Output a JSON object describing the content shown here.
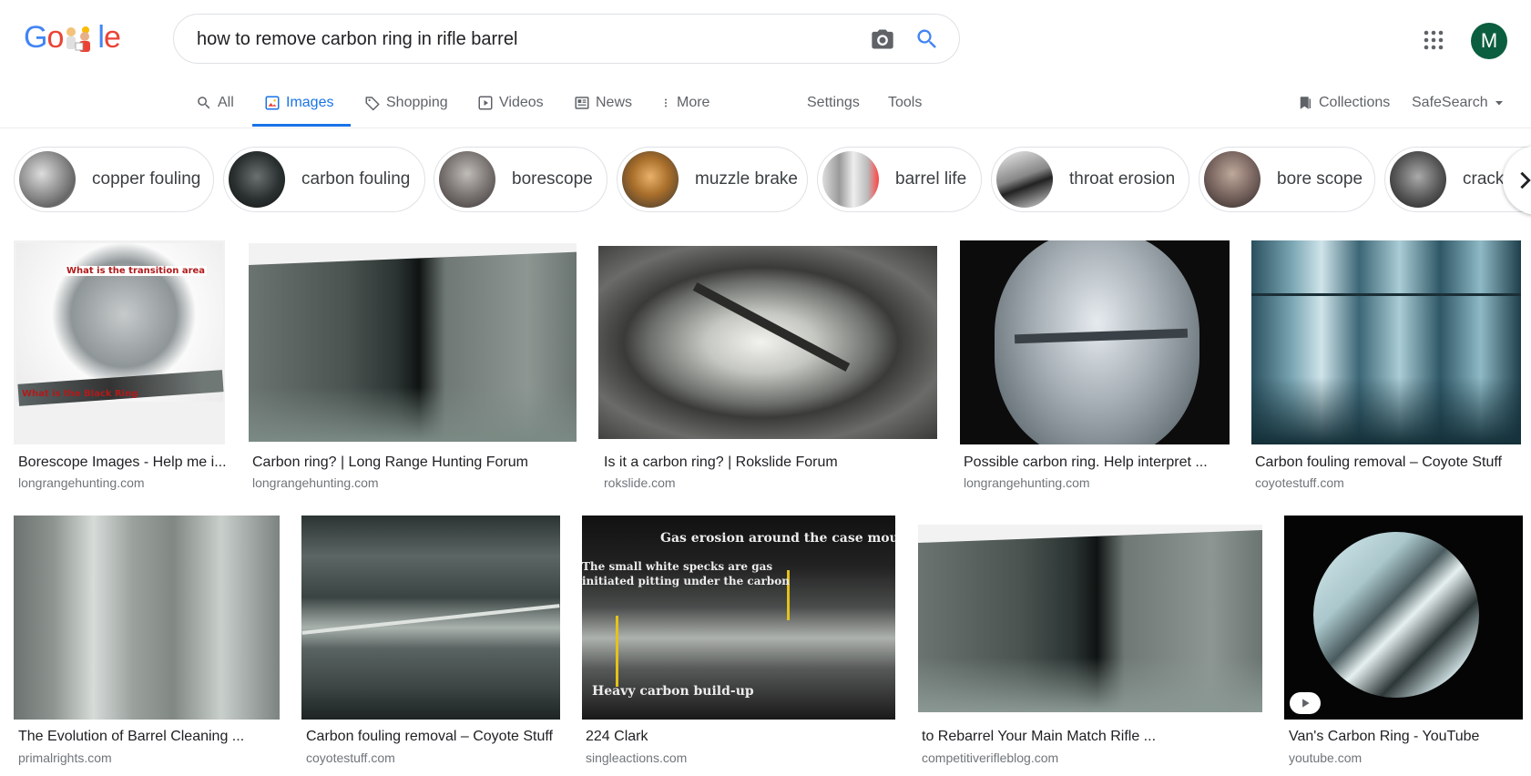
{
  "header": {
    "logo_text": "Google",
    "search_query": "how to remove carbon ring in rifle barrel",
    "avatar_letter": "M"
  },
  "tabs": [
    {
      "label": "All",
      "icon": "search-icon"
    },
    {
      "label": "Images",
      "icon": "image-icon",
      "active": true
    },
    {
      "label": "Shopping",
      "icon": "tag-icon"
    },
    {
      "label": "Videos",
      "icon": "video-icon"
    },
    {
      "label": "News",
      "icon": "news-icon"
    },
    {
      "label": "More",
      "icon": "more-vert-icon"
    }
  ],
  "tools": {
    "settings": "Settings",
    "tools": "Tools",
    "collections": "Collections",
    "safesearch": "SafeSearch"
  },
  "chips": [
    {
      "label": "copper fouling"
    },
    {
      "label": "carbon fouling"
    },
    {
      "label": "borescope"
    },
    {
      "label": "muzzle brake"
    },
    {
      "label": "barrel life"
    },
    {
      "label": "throat erosion"
    },
    {
      "label": "bore scope"
    },
    {
      "label": "cracking"
    }
  ],
  "results": [
    {
      "title": "Borescope Images - Help me i...",
      "site": "longrangehunting.com",
      "overlay": [
        "What is the transition area",
        "What is the Black Ring"
      ]
    },
    {
      "title": "Carbon ring? | Long Range Hunting Forum",
      "site": "longrangehunting.com"
    },
    {
      "title": "Is it a carbon ring? | Rokslide Forum",
      "site": "rokslide.com"
    },
    {
      "title": "Possible carbon ring. Help interpret ...",
      "site": "longrangehunting.com"
    },
    {
      "title": "Carbon fouling removal – Coyote Stuff",
      "site": "coyotestuff.com"
    },
    {
      "title": "The Evolution of Barrel Cleaning ...",
      "site": "primalrights.com"
    },
    {
      "title": "Carbon fouling removal – Coyote Stuff",
      "site": "coyotestuff.com"
    },
    {
      "title": "224 Clark",
      "site": "singleactions.com",
      "overlay": [
        "Gas erosion around the case mouth",
        "The small white specks are gas",
        "initiated pitting under the carbon",
        "Heavy carbon build-up"
      ]
    },
    {
      "title": "to Rebarrel Your Main Match Rifle ...",
      "site": "competitiverifleblog.com"
    },
    {
      "title": "Van's Carbon Ring - YouTube",
      "site": "youtube.com"
    }
  ]
}
